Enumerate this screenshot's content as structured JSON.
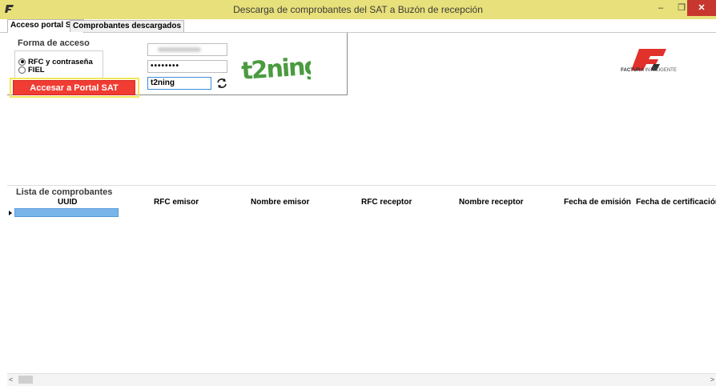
{
  "window": {
    "title": "Descarga de comprobantes del SAT a Buzón de recepción",
    "minimize": "–",
    "restore": "❐",
    "close": "✕",
    "accent_color": "#e8e07a",
    "close_color": "#c7372f"
  },
  "tabs": [
    {
      "label": "Acceso portal SAT",
      "active": true
    },
    {
      "label": "Comprobantes descargados",
      "active": false
    }
  ],
  "access": {
    "group_label": "Forma de acceso",
    "options": [
      {
        "label": "RFC y contraseña",
        "checked": true
      },
      {
        "label": "FIEL",
        "checked": false
      }
    ],
    "button_label": "Accesar a Portal SAT",
    "button_color": "#f03c32",
    "rfc_value": "",
    "password_value": "••••••••",
    "captcha_value": "t2ning",
    "captcha_image_text": "t2ning",
    "refresh_icon": "refresh-icon"
  },
  "logo": {
    "brand": "FACTURA",
    "brand_suffix": "INTELIGENTE"
  },
  "list": {
    "label": "Lista de comprobantes",
    "columns": [
      "UUID",
      "RFC emisor",
      "Nombre emisor",
      "RFC receptor",
      "Nombre receptor",
      "Fecha de emisión",
      "Fecha de certificación"
    ],
    "selection_color": "#7ab5ea"
  },
  "scrollbar": {
    "left": "<",
    "right": ">"
  }
}
